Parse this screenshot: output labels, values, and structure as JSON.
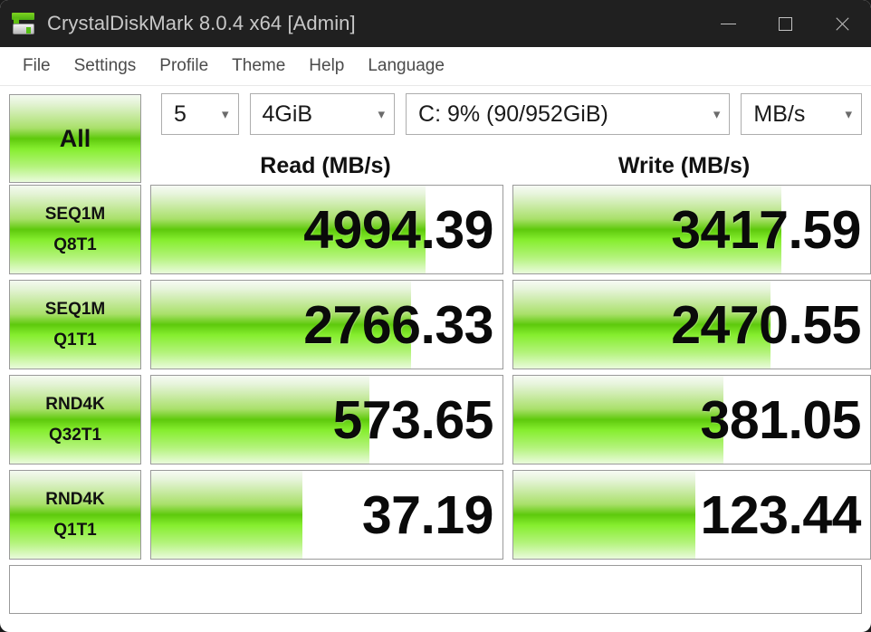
{
  "window": {
    "title": "CrystalDiskMark 8.0.4 x64 [Admin]",
    "icon": "crystaldiskmark-icon",
    "controls": {
      "minimize": "minimize-icon",
      "maximize": "maximize-icon",
      "close": "close-icon"
    }
  },
  "menu": {
    "items": [
      {
        "label": "File"
      },
      {
        "label": "Settings"
      },
      {
        "label": "Profile"
      },
      {
        "label": "Theme"
      },
      {
        "label": "Help"
      },
      {
        "label": "Language"
      }
    ]
  },
  "toolbar": {
    "all_button": "All",
    "runs": {
      "value": "5",
      "chevron": "chevron-down-icon"
    },
    "test_size": {
      "value": "4GiB",
      "chevron": "chevron-down-icon"
    },
    "drive": {
      "value": "C: 9% (90/952GiB)",
      "chevron": "chevron-down-icon"
    },
    "unit": {
      "value": "MB/s",
      "chevron": "chevron-down-icon"
    }
  },
  "columns": {
    "read": "Read (MB/s)",
    "write": "Write (MB/s)"
  },
  "status": {
    "text": ""
  },
  "colors": {
    "accent_green": "#5ec90c",
    "accent_green_light": "#86ee2f",
    "titlebar": "#202020",
    "title_text": "#c8c8c8"
  },
  "chart_data": {
    "type": "bar",
    "title": "CrystalDiskMark 8.0.4 Benchmark Results",
    "unit": "MB/s",
    "drive": "C: 9% (90/952GiB)",
    "test_size": "4GiB",
    "runs": 5,
    "categories": [
      "SEQ1M Q8T1",
      "SEQ1M Q1T1",
      "RND4K Q32T1",
      "RND4K Q1T1"
    ],
    "series": [
      {
        "name": "Read (MB/s)",
        "values": [
          4994.39,
          2766.33,
          573.65,
          37.19
        ]
      },
      {
        "name": "Write (MB/s)",
        "values": [
          3417.59,
          2470.55,
          381.05,
          123.44
        ]
      }
    ],
    "rows": [
      {
        "label_top": "SEQ1M",
        "label_bottom": "Q8T1",
        "read": "4994.39",
        "write": "3417.59",
        "read_fill_pct": 78,
        "write_fill_pct": 75
      },
      {
        "label_top": "SEQ1M",
        "label_bottom": "Q1T1",
        "read": "2766.33",
        "write": "2470.55",
        "read_fill_pct": 74,
        "write_fill_pct": 72
      },
      {
        "label_top": "RND4K",
        "label_bottom": "Q32T1",
        "read": "573.65",
        "write": "381.05",
        "read_fill_pct": 62,
        "write_fill_pct": 59
      },
      {
        "label_top": "RND4K",
        "label_bottom": "Q1T1",
        "read": "37.19",
        "write": "123.44",
        "read_fill_pct": 43,
        "write_fill_pct": 51
      }
    ],
    "xlabel": "",
    "ylabel": "MB/s",
    "legend": [
      "Read (MB/s)",
      "Write (MB/s)"
    ]
  }
}
